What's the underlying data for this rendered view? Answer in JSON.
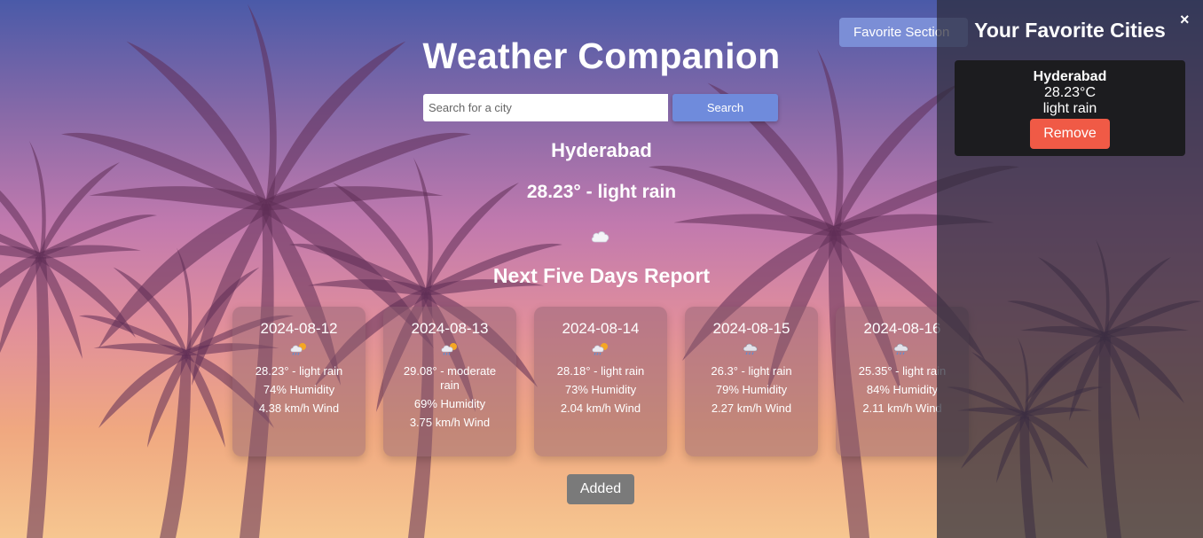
{
  "header": {
    "title": "Weather Companion",
    "favorite_button_label": "Favorite Section"
  },
  "search": {
    "placeholder": "Search for a city",
    "button_label": "Search"
  },
  "current": {
    "city": "Hyderabad",
    "summary": "28.23° - light rain",
    "icon": "cloud-icon"
  },
  "forecast": {
    "title": "Next Five Days Report",
    "days": [
      {
        "date": "2024-08-12",
        "icon": "sun-rain-cloud-icon",
        "summary": "28.23° - light rain",
        "humidity": "74% Humidity",
        "wind": "4.38 km/h Wind"
      },
      {
        "date": "2024-08-13",
        "icon": "sun-rain-cloud-icon",
        "summary": "29.08° - moderate rain",
        "humidity": "69% Humidity",
        "wind": "3.75 km/h Wind"
      },
      {
        "date": "2024-08-14",
        "icon": "sun-rain-cloud-icon",
        "summary": "28.18° - light rain",
        "humidity": "73% Humidity",
        "wind": "2.04 km/h Wind"
      },
      {
        "date": "2024-08-15",
        "icon": "rain-cloud-icon",
        "summary": "26.3° - light rain",
        "humidity": "79% Humidity",
        "wind": "2.27 km/h Wind"
      },
      {
        "date": "2024-08-16",
        "icon": "rain-cloud-icon",
        "summary": "25.35° - light rain",
        "humidity": "84% Humidity",
        "wind": "2.11 km/h Wind"
      }
    ]
  },
  "added_button_label": "Added",
  "favorites_panel": {
    "title": "Your Favorite Cities",
    "close_label": "×",
    "cities": [
      {
        "name": "Hyderabad",
        "temp": "28.23°C",
        "description": "light rain",
        "remove_label": "Remove"
      }
    ]
  },
  "colors": {
    "favorite_button": "#7b8ed6",
    "search_button": "#6f8bdc",
    "remove_button": "#f05a46",
    "added_button": "#7a7a7a",
    "panel_card": "#1c1c1f"
  }
}
